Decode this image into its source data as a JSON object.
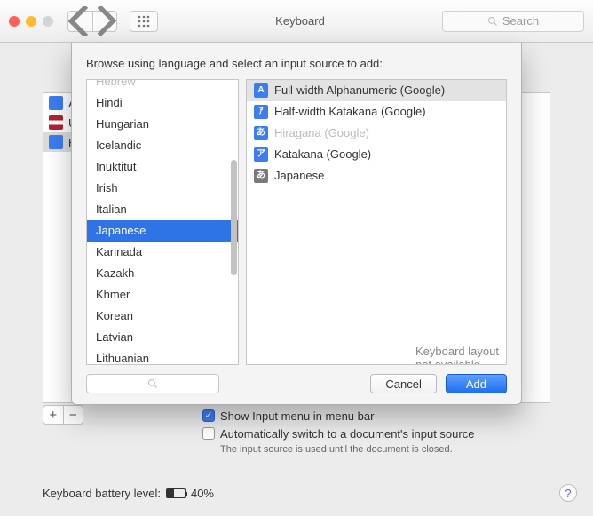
{
  "window": {
    "title": "Keyboard"
  },
  "toolbar": {
    "search_placeholder": "Search"
  },
  "behind": {
    "sources": [
      {
        "label": "A",
        "cls": "blue"
      },
      {
        "label": "U",
        "cls": "flag"
      },
      {
        "label": "H",
        "cls": "hira",
        "selected": true
      }
    ],
    "add": "+",
    "remove": "−",
    "check1": "Show Input menu in menu bar",
    "check2": "Automatically switch to a document's input source",
    "hint": "The input source is used until the document is closed."
  },
  "battery": {
    "label": "Keyboard battery level:",
    "value": "40%"
  },
  "sheet": {
    "prompt": "Browse using language and select an input source to add:",
    "languages": [
      "Hebrew",
      "Hindi",
      "Hungarian",
      "Icelandic",
      "Inuktitut",
      "Irish",
      "Italian",
      "Japanese",
      "Kannada",
      "Kazakh",
      "Khmer",
      "Korean",
      "Latvian",
      "Lithuanian"
    ],
    "selected_language_index": 7,
    "sources": [
      {
        "label": "Full-width Alphanumeric (Google)",
        "glyph": "A",
        "color": "c-blue",
        "selected": true
      },
      {
        "label": "Half-width Katakana (Google)",
        "glyph": "ｱ",
        "color": "c-blue"
      },
      {
        "label": "Hiragana (Google)",
        "glyph": "あ",
        "color": "c-blue",
        "disabled": true
      },
      {
        "label": "Katakana (Google)",
        "glyph": "ア",
        "color": "c-blue"
      },
      {
        "label": "Japanese",
        "glyph": "あ",
        "color": "c-grey"
      }
    ],
    "preview_msg": "Keyboard layout not available",
    "cancel": "Cancel",
    "add": "Add"
  }
}
